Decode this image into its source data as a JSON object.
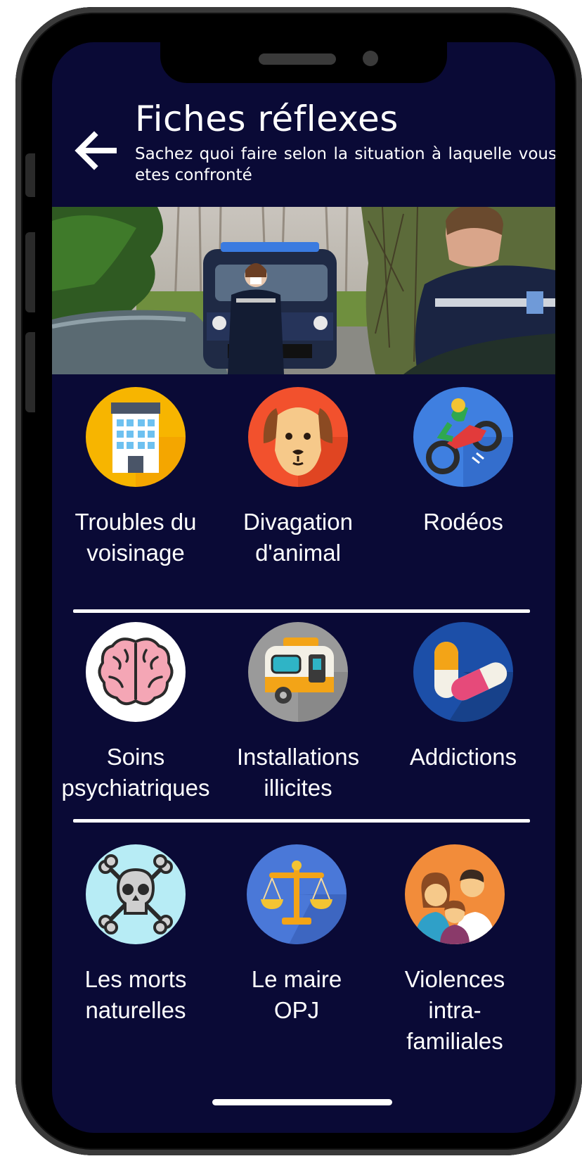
{
  "header": {
    "title": "Fiches réflexes",
    "subtitle": "Sachez quoi faire selon la situation à laquelle vous etes confronté"
  },
  "categories": [
    {
      "label": "Troubles du\nvoisinage",
      "icon": "building-icon",
      "color": "#f4b400"
    },
    {
      "label": "Divagation\nd'animal",
      "icon": "dog-icon",
      "color": "#f05a28"
    },
    {
      "label": "Rodéos",
      "icon": "motocross-icon",
      "color": "#3f7fe0"
    },
    {
      "label": "Soins\npsychiatriques",
      "icon": "brain-icon",
      "color": "#ffffff"
    },
    {
      "label": "Installations\nillicites",
      "icon": "caravan-icon",
      "color": "#9a9a9a"
    },
    {
      "label": "Addictions",
      "icon": "pill-icon",
      "color": "#1c4fa8"
    },
    {
      "label": "Les morts\nnaturelles",
      "icon": "skull-crossbones-icon",
      "color": "#b7ecf5"
    },
    {
      "label": "Le maire\nOPJ",
      "icon": "scales-icon",
      "color": "#4a78d8"
    },
    {
      "label": "Violences\nintra-\nfamiliales",
      "icon": "family-icon",
      "color": "#f28c3a"
    }
  ]
}
